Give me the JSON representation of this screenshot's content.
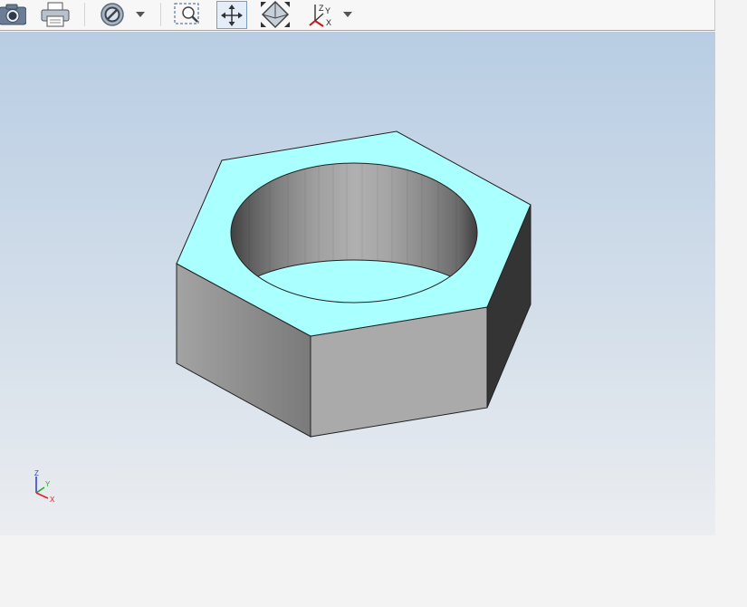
{
  "toolbar": {
    "buttons": [
      {
        "name": "capture-image",
        "icon": "camera-icon"
      },
      {
        "name": "print",
        "icon": "printer-icon"
      },
      {
        "name": "display-mode",
        "icon": "no-entry-icon",
        "has_dropdown": true
      },
      {
        "name": "zoom-window",
        "icon": "zoom-window-icon"
      },
      {
        "name": "pan",
        "icon": "pan-icon",
        "pressed": true
      },
      {
        "name": "rotate",
        "icon": "rotate-view-icon"
      },
      {
        "name": "view-orientation",
        "icon": "axes-orientation-icon",
        "has_dropdown": true
      }
    ],
    "axes_icon_labels": {
      "z": "Z",
      "y": "Y",
      "x": "X"
    }
  },
  "viewport": {
    "background_top": "#b8cde3",
    "background_bottom": "#ebedf0",
    "model": {
      "type": "hex-nut",
      "top_face_color": "#aaffff",
      "side_colors": [
        "#9e9e9e",
        "#aaaaaa",
        "#343434"
      ]
    },
    "triad": {
      "z_label": "Z",
      "y_label": "Y",
      "x_label": "X",
      "z_color": "#3344cc",
      "y_color": "#22aa22",
      "x_color": "#dd2222"
    }
  }
}
